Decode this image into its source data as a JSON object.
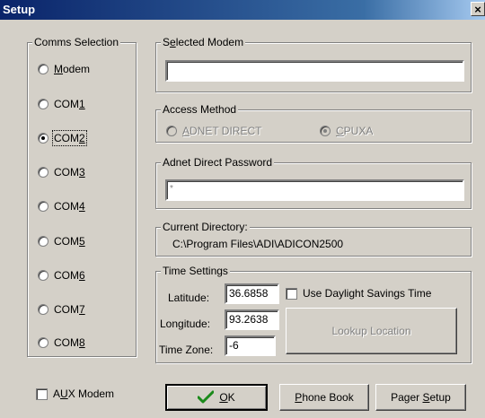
{
  "window": {
    "title": "Setup",
    "close_glyph": "×"
  },
  "comms": {
    "legend": "Comms Selection",
    "selected": "COM2",
    "options": [
      {
        "pre": "",
        "u": "M",
        "post": "odem"
      },
      {
        "pre": "COM",
        "u": "1",
        "post": ""
      },
      {
        "pre": "COM",
        "u": "2",
        "post": ""
      },
      {
        "pre": "COM",
        "u": "3",
        "post": ""
      },
      {
        "pre": "COM",
        "u": "4",
        "post": ""
      },
      {
        "pre": "COM",
        "u": "5",
        "post": ""
      },
      {
        "pre": "COM",
        "u": "6",
        "post": ""
      },
      {
        "pre": "COM",
        "u": "7",
        "post": ""
      },
      {
        "pre": "COM",
        "u": "8",
        "post": ""
      }
    ]
  },
  "aux": {
    "pre": "A",
    "u": "U",
    "post": "X Modem"
  },
  "selected_modem": {
    "legend_pre": "S",
    "legend_u": "e",
    "legend_post": "lected Modem",
    "value": ""
  },
  "access": {
    "legend": "Access Method",
    "adnet": {
      "pre": "",
      "u": "A",
      "post": "DNET DIRECT"
    },
    "cpuxa": {
      "pre": "",
      "u": "C",
      "post": "PUXA"
    }
  },
  "password": {
    "legend": "Adnet Direct Password",
    "value": "*"
  },
  "directory": {
    "legend": "Current Directory:",
    "value": "C:\\Program Files\\ADI\\ADICON2500"
  },
  "time": {
    "legend": "Time Settings",
    "latitude_label": "Latitude:",
    "latitude": "36.6858",
    "longitude_label": "Longitude:",
    "longitude": "93.2638",
    "timezone_label": "Time Zone:",
    "timezone": "-6",
    "dst_label": "Use Daylight Savings Time",
    "lookup_label": "Lookup Location"
  },
  "buttons": {
    "ok": {
      "pre": "",
      "u": "O",
      "post": "K"
    },
    "phone": {
      "pre": "",
      "u": "P",
      "post": "hone Book"
    },
    "pager": {
      "pre": "Pager ",
      "u": "S",
      "post": "etup"
    }
  },
  "icons": {
    "ok": "checkmark-icon",
    "ok_color": "#1a8a1a"
  }
}
